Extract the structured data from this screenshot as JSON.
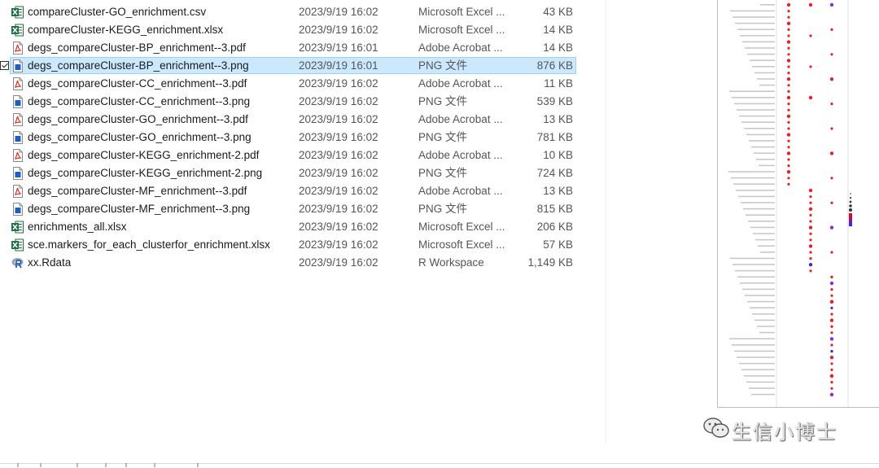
{
  "files": [
    {
      "name": "compareCluster-GO_enrichment.csv",
      "date": "2023/9/19 16:02",
      "type": "Microsoft Excel ...",
      "size": "43 KB",
      "icon": "excel-icon",
      "selected": false
    },
    {
      "name": "compareCluster-KEGG_enrichment.xlsx",
      "date": "2023/9/19 16:02",
      "type": "Microsoft Excel ...",
      "size": "14 KB",
      "icon": "excel-icon",
      "selected": false
    },
    {
      "name": "degs_compareCluster-BP_enrichment--3.pdf",
      "date": "2023/9/19 16:01",
      "type": "Adobe Acrobat ...",
      "size": "14 KB",
      "icon": "pdf-icon",
      "selected": false
    },
    {
      "name": "degs_compareCluster-BP_enrichment--3.png",
      "date": "2023/9/19 16:01",
      "type": "PNG 文件",
      "size": "876 KB",
      "icon": "png-icon",
      "selected": true
    },
    {
      "name": "degs_compareCluster-CC_enrichment--3.pdf",
      "date": "2023/9/19 16:02",
      "type": "Adobe Acrobat ...",
      "size": "11 KB",
      "icon": "pdf-icon",
      "selected": false
    },
    {
      "name": "degs_compareCluster-CC_enrichment--3.png",
      "date": "2023/9/19 16:02",
      "type": "PNG 文件",
      "size": "539 KB",
      "icon": "png-icon",
      "selected": false
    },
    {
      "name": "degs_compareCluster-GO_enrichment--3.pdf",
      "date": "2023/9/19 16:02",
      "type": "Adobe Acrobat ...",
      "size": "13 KB",
      "icon": "pdf-icon",
      "selected": false
    },
    {
      "name": "degs_compareCluster-GO_enrichment--3.png",
      "date": "2023/9/19 16:02",
      "type": "PNG 文件",
      "size": "781 KB",
      "icon": "png-icon",
      "selected": false
    },
    {
      "name": "degs_compareCluster-KEGG_enrichment-2.pdf",
      "date": "2023/9/19 16:02",
      "type": "Adobe Acrobat ...",
      "size": "10 KB",
      "icon": "pdf-icon",
      "selected": false
    },
    {
      "name": "degs_compareCluster-KEGG_enrichment-2.png",
      "date": "2023/9/19 16:02",
      "type": "PNG 文件",
      "size": "724 KB",
      "icon": "png-icon",
      "selected": false
    },
    {
      "name": "degs_compareCluster-MF_enrichment--3.pdf",
      "date": "2023/9/19 16:02",
      "type": "Adobe Acrobat ...",
      "size": "13 KB",
      "icon": "pdf-icon",
      "selected": false
    },
    {
      "name": "degs_compareCluster-MF_enrichment--3.png",
      "date": "2023/9/19 16:02",
      "type": "PNG 文件",
      "size": "815 KB",
      "icon": "png-icon",
      "selected": false
    },
    {
      "name": "enrichments_all.xlsx",
      "date": "2023/9/19 16:02",
      "type": "Microsoft Excel ...",
      "size": "206 KB",
      "icon": "excel-icon",
      "selected": false
    },
    {
      "name": "sce.markers_for_each_clusterfor_enrichment.xlsx",
      "date": "2023/9/19 16:02",
      "type": "Microsoft Excel ...",
      "size": "57 KB",
      "icon": "excel-icon",
      "selected": false
    },
    {
      "name": "xx.Rdata",
      "date": "2023/9/19 16:02",
      "type": "R Workspace",
      "size": "1,149 KB",
      "icon": "r-icon",
      "selected": false
    }
  ],
  "preview": {
    "watermark_text": "生信小博士",
    "watermark_icon": "wechat-icon"
  },
  "colors": {
    "selection_bg": "#cce8ff",
    "selection_border": "#99d1ff",
    "excel_green": "#1d6f42",
    "pdf_red": "#d93025",
    "png_blue": "#1f5fbf",
    "dot_red": "#e8202a",
    "dot_purple": "#8a2be2"
  }
}
